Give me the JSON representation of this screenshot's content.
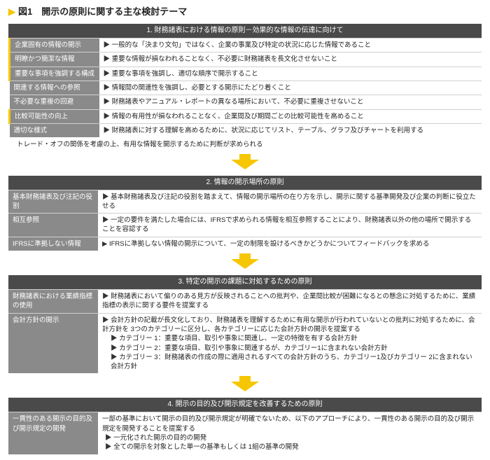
{
  "figure_title": "図1　開示の原則に関する主な検討テーマ",
  "s1": {
    "header": "1. 財務諸表における情報の原則－効果的な情報の伝達に向けて",
    "rows": [
      {
        "label": "企業固有の情報の開示",
        "desc": "一般的な「決まり文句」ではなく、企業の事業及び特定の状況に応じた情報であること",
        "hl": true
      },
      {
        "label": "明瞭かつ簡潔な情報",
        "desc": "重要な情報が損なわれることなく、不必要に財務諸表を長文化させないこと",
        "hl": true
      },
      {
        "label": "重要な事項を強調する構成",
        "desc": "重要な事項を強調し、適切な順序で開示すること",
        "hl": true
      },
      {
        "label": "関連する情報への参照",
        "desc": "情報間の関連性を強調し、必要とする開示にたどり着くこと",
        "hl": false
      },
      {
        "label": "不必要な重複の回避",
        "desc": "財務諸表やアニュアル・レポートの異なる場所において、不必要に重複させないこと",
        "hl": false
      },
      {
        "label": "比較可能性の向上",
        "desc": "情報の有用性が損なわれることなく、企業間及び期間ごとの比較可能性を高めること",
        "hl": true
      },
      {
        "label": "適切な様式",
        "desc": "財務諸表に対する理解を高めるために、状況に応じてリスト、テーブル、グラフ及びチャートを利用する",
        "hl": false
      }
    ],
    "note": "トレード・オフの関係を考慮の上、有用な情報を開示するために判断が求められる"
  },
  "s2": {
    "header": "2. 情報の開示場所の原則",
    "rows": [
      {
        "label": "基本財務諸表及び注記の役割",
        "desc": "基本財務諸表及び注記の役割を踏まえて、情報の開示場所の在り方を示し、開示に関する基準開発及び企業の判断に役立たせる"
      },
      {
        "label": "相互参照",
        "desc": "一定の要件を満たした場合には、IFRSで求められる情報を相互参照することにより、財務諸表以外の他の場所で開示することを容認する"
      },
      {
        "label": "IFRSに準拠しない情報",
        "desc": "IFRSに準拠しない情報の開示について、一定の制限を設けるべきかどうかについてフィードバックを求める"
      }
    ]
  },
  "s3": {
    "header": "3. 特定の開示の課題に対処するための原則",
    "r1": {
      "label": "財務諸表における業績指標の使用",
      "desc": "財務諸表において偏りのある見方が反映されることへの批判や、企業間比較が困難になるとの懸念に対処するために、業績指標の表示に関する要件を提案する"
    },
    "r2": {
      "label": "会計方針の開示",
      "lead": "会計方針の記載が長文化しており、財務諸表を理解するために有用な開示が行われていないとの批判に対処するために、会計方針を 3つのカテゴリーに区分し、各カテゴリーに応じた会計方針の開示を提案する",
      "c1": "カテゴリー 1：重要な項目、取引や事象に関連し、一定の特徴を有する会計方針",
      "c2": "カテゴリー 2：重要な項目、取引や事象に関連するが、カテゴリー1に含まれない会計方針",
      "c3": "カテゴリー 3：財務諸表の作成の際に適用されるすべての会計方針のうち、カテゴリー1及びカテゴリー 2に含まれない会計方針"
    }
  },
  "s4": {
    "header": "4. 開示の目的及び開示規定を改善するための原則",
    "r": {
      "label": "一貫性のある開示の目的及び開示規定の開発",
      "lead": "一部の基準において開示の目的及び開示規定が明確でないため、以下のアプローチにより、一貫性のある開示の目的及び開示規定を開発することを提案する",
      "b1": "一元化された開示の目的の開発",
      "b2": "全ての開示を対象とした単一の基準もしくは 1組の基準の開発"
    }
  }
}
